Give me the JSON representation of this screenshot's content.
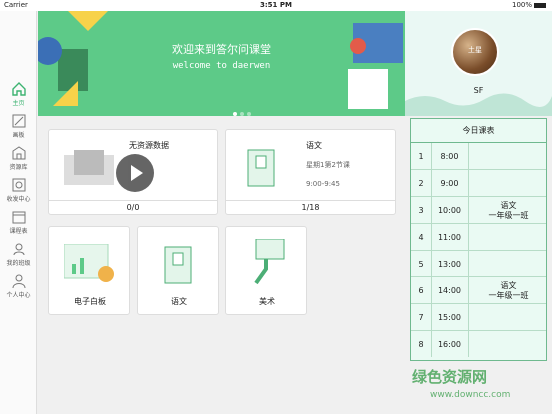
{
  "status_bar": {
    "carrier": "Carrier",
    "time": "3:51 PM",
    "battery": "100%"
  },
  "sidebar": {
    "items": [
      {
        "label": "主页",
        "icon": "home-icon"
      },
      {
        "label": "画板",
        "icon": "pencil-icon"
      },
      {
        "label": "资源库",
        "icon": "library-icon"
      },
      {
        "label": "收发中心",
        "icon": "inbox-icon"
      },
      {
        "label": "课程表",
        "icon": "calendar-icon"
      },
      {
        "label": "我的班级",
        "icon": "class-icon"
      },
      {
        "label": "个人中心",
        "icon": "person-icon"
      }
    ]
  },
  "banner": {
    "title_cn": "欢迎来到答尔问课堂",
    "title_en": "welcome to daerwen"
  },
  "profile": {
    "avatar_label": "土星",
    "name": "SF"
  },
  "cards": {
    "resource": {
      "title": "无资源数据",
      "footer": "0/0"
    },
    "lesson": {
      "title": "语文",
      "subtitle": "星期1第2节课",
      "time": "9:00-9:45",
      "footer": "1/18"
    },
    "apps": [
      {
        "label": "电子白板"
      },
      {
        "label": "语文"
      },
      {
        "label": "美术"
      }
    ]
  },
  "schedule": {
    "title": "今日课表",
    "rows": [
      {
        "n": "1",
        "time": "8:00",
        "c1": "",
        "c2": ""
      },
      {
        "n": "2",
        "time": "9:00",
        "c1": "",
        "c2": ""
      },
      {
        "n": "3",
        "time": "10:00",
        "c1": "语文",
        "c2": "一年级一班"
      },
      {
        "n": "4",
        "time": "11:00",
        "c1": "",
        "c2": ""
      },
      {
        "n": "5",
        "time": "13:00",
        "c1": "",
        "c2": ""
      },
      {
        "n": "6",
        "time": "14:00",
        "c1": "语文",
        "c2": "一年级一班"
      },
      {
        "n": "7",
        "time": "15:00",
        "c1": "",
        "c2": ""
      },
      {
        "n": "8",
        "time": "16:00",
        "c1": "",
        "c2": ""
      }
    ]
  },
  "watermark": {
    "cn": "绿色资源网",
    "url": "www.downcc.com"
  }
}
